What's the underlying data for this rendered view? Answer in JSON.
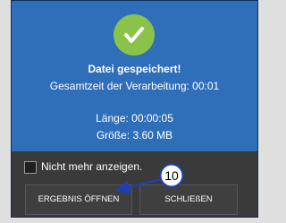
{
  "dialog": {
    "title": "Datei gespeichert!",
    "total_time": "Gesamtzeit der Verarbeitung: 00:01",
    "length": "Länge: 00:00:05",
    "size": "Größe: 3.60 MB",
    "checkbox_label": "Nicht mehr anzeigen.",
    "checkbox_checked": false,
    "open_result_label": "ERGEBNIS ÖFFNEN",
    "close_label": "SCHLIEßEN"
  },
  "annotation": {
    "number": "10"
  },
  "colors": {
    "dialog_top": "#2f6fba",
    "dialog_bottom": "#3a3a3a",
    "success_circle": "#8bc34a",
    "annotation_arrow": "#1f3fb8"
  },
  "icons": {
    "success": "check-icon"
  }
}
